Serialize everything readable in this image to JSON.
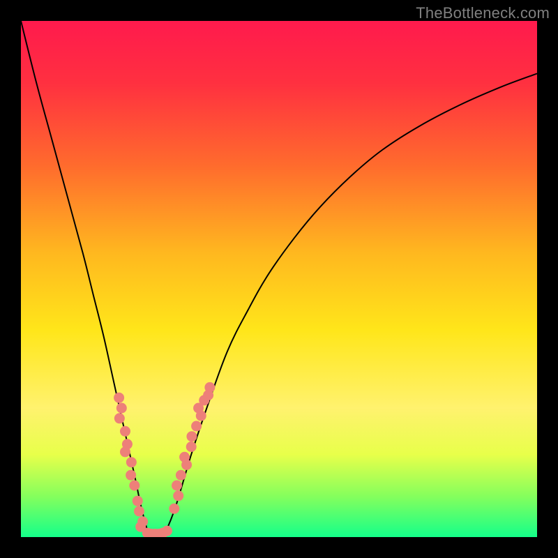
{
  "watermark": "TheBottleneck.com",
  "chart_data": {
    "type": "line",
    "title": "",
    "xlabel": "",
    "ylabel": "",
    "xlim": [
      0,
      100
    ],
    "ylim": [
      0,
      100
    ],
    "background_gradient": {
      "stops": [
        {
          "offset": 0.0,
          "color": "#ff1a4d"
        },
        {
          "offset": 0.12,
          "color": "#ff3040"
        },
        {
          "offset": 0.28,
          "color": "#ff6b2d"
        },
        {
          "offset": 0.45,
          "color": "#ffb81f"
        },
        {
          "offset": 0.6,
          "color": "#ffe61a"
        },
        {
          "offset": 0.75,
          "color": "#fff26e"
        },
        {
          "offset": 0.84,
          "color": "#e8ff4a"
        },
        {
          "offset": 0.92,
          "color": "#86ff5c"
        },
        {
          "offset": 1.0,
          "color": "#14ff8a"
        }
      ]
    },
    "series": [
      {
        "name": "curve",
        "x": [
          0,
          3,
          6,
          9,
          12,
          14,
          16,
          18,
          20,
          22,
          23.5,
          25,
          26,
          27,
          28,
          30,
          33,
          36,
          40,
          44,
          48,
          53,
          58,
          64,
          70,
          77,
          85,
          93,
          100
        ],
        "y": [
          100,
          88,
          77,
          66,
          55,
          47,
          39,
          30,
          21,
          12,
          5,
          0,
          0,
          0,
          1,
          6,
          16,
          25,
          36,
          44,
          51,
          58,
          64,
          70,
          75,
          79.5,
          83.7,
          87.2,
          89.8
        ]
      },
      {
        "name": "dots-left",
        "type": "scatter",
        "color": "#ed8079",
        "x": [
          19.0,
          19.5,
          19.1,
          20.2,
          20.6,
          20.2,
          21.4,
          21.3,
          22.0,
          22.6,
          22.9,
          23.6,
          23.2
        ],
        "y": [
          27.0,
          25.0,
          23.0,
          20.5,
          18.0,
          16.5,
          14.5,
          12.0,
          10.0,
          7.0,
          5.0,
          3.0,
          2.0
        ]
      },
      {
        "name": "dots-bottom",
        "type": "scatter",
        "color": "#ed8079",
        "x": [
          24.5,
          25.2,
          26.0,
          26.8,
          27.5,
          28.3
        ],
        "y": [
          0.8,
          0.6,
          0.6,
          0.6,
          0.8,
          1.2
        ]
      },
      {
        "name": "dots-right",
        "type": "scatter",
        "color": "#ed8079",
        "x": [
          29.7,
          30.5,
          30.2,
          31.0,
          32.1,
          31.7,
          33.0,
          33.1,
          34.0,
          34.9,
          34.4,
          35.5,
          36.6,
          36.3
        ],
        "y": [
          5.5,
          8.0,
          10.0,
          12.0,
          14.0,
          15.5,
          17.5,
          19.5,
          21.5,
          23.5,
          25.0,
          26.5,
          29.0,
          27.5
        ]
      }
    ]
  }
}
